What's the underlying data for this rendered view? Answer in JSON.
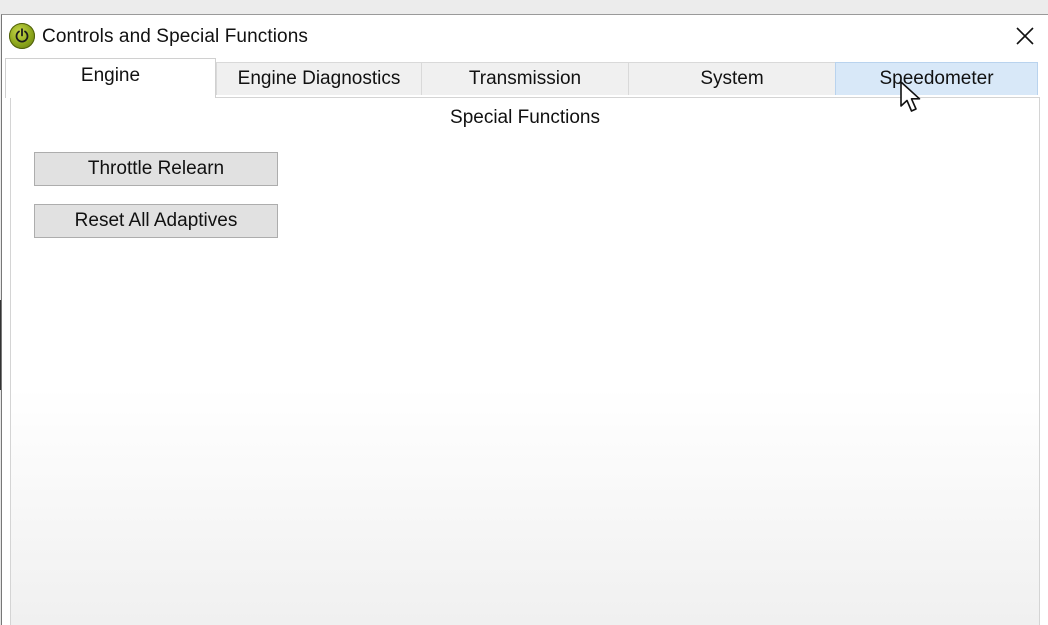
{
  "window": {
    "title": "Controls and Special Functions",
    "icon": "power-icon",
    "icon_color": "#8aa41a"
  },
  "tabs": [
    {
      "label": "Engine",
      "state": "active"
    },
    {
      "label": "Engine Diagnostics",
      "state": "normal"
    },
    {
      "label": "Transmission",
      "state": "normal"
    },
    {
      "label": "System",
      "state": "normal"
    },
    {
      "label": "Speedometer",
      "state": "hover"
    }
  ],
  "panel": {
    "section_title": "Special Functions",
    "buttons": [
      {
        "label": "Throttle Relearn"
      },
      {
        "label": "Reset All Adaptives"
      }
    ]
  },
  "colors": {
    "hover_tab": "#d8e8f8",
    "button_face": "#e1e1e1"
  }
}
